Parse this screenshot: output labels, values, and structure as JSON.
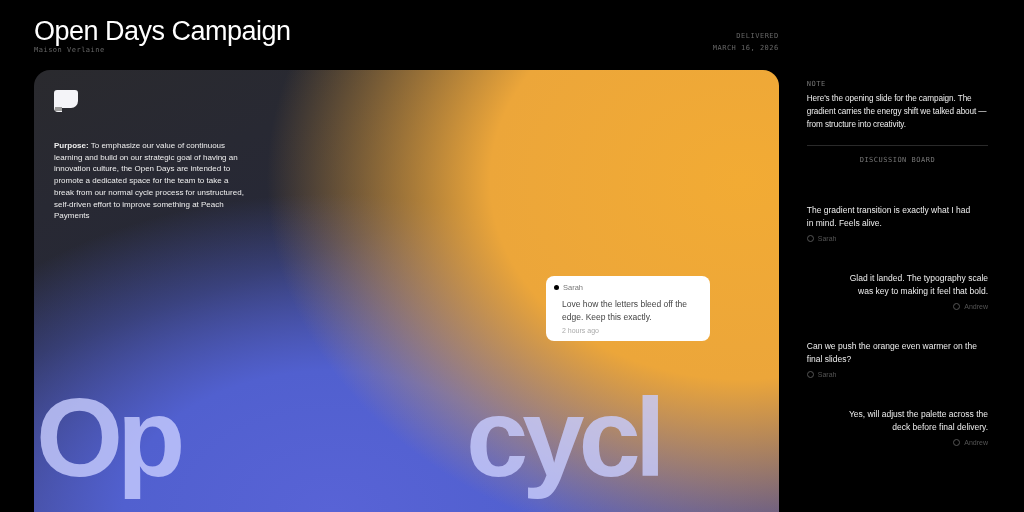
{
  "header": {
    "title": "Open Days Campaign",
    "client": "Maison Verlaine",
    "status_label": "DELIVERED",
    "date": "MARCH 16, 2026"
  },
  "slide": {
    "purpose": "**Purpose:** To emphasize our value of continuous learning and build on our strategic goal of having an innovation culture, the Open Days are intended to promote a dedicated space for the team to take a break from our normal cycle process for unstructured, self-driven effort to improve something at Peach Payments",
    "big_words": [
      "Op",
      "cycl"
    ],
    "comment": {
      "author": "Sarah",
      "text": "Love how the letters bleed off the edge. Keep this exactly.",
      "time": "2 hours ago"
    }
  },
  "note": {
    "label": "NOTE",
    "text": "Here's the opening slide for the campaign. The gradient carries the energy shift we talked about — from structure into creativity."
  },
  "discussion": {
    "title": "DISCUSSION BOARD",
    "comments": [
      {
        "text": "The gradient transition is exactly what I had in mind. Feels alive.",
        "author": "Sarah",
        "kind": "left"
      },
      {
        "text": "Glad it landed. The typography scale was key to making it feel that bold.",
        "author": "Andrew",
        "kind": "right"
      },
      {
        "text": "Can we push the orange even warmer on the final slides?",
        "author": "Sarah",
        "kind": "left"
      },
      {
        "text": "Yes, will adjust the palette across the deck before final delivery.",
        "author": "Andrew",
        "kind": "right"
      }
    ]
  }
}
